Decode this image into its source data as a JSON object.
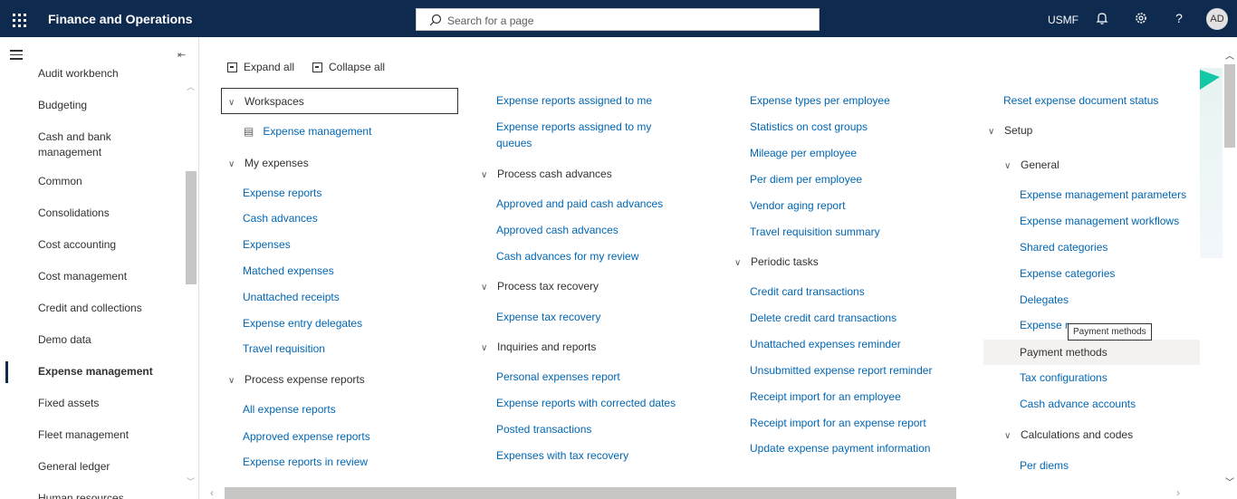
{
  "topbar": {
    "app_title": "Finance and Operations",
    "search_placeholder": "Search for a page",
    "company": "USMF",
    "avatar_initials": "AD",
    "icons": [
      "waffle-icon",
      "search-icon",
      "bell-icon",
      "gear-icon",
      "help-icon"
    ]
  },
  "nav": {
    "items": [
      {
        "label": "Audit workbench"
      },
      {
        "label": "Budgeting"
      },
      {
        "label": "Cash and bank management"
      },
      {
        "label": "Common"
      },
      {
        "label": "Consolidations"
      },
      {
        "label": "Cost accounting"
      },
      {
        "label": "Cost management"
      },
      {
        "label": "Credit and collections"
      },
      {
        "label": "Demo data"
      },
      {
        "label": "Expense management"
      },
      {
        "label": "Fixed assets"
      },
      {
        "label": "Fleet management"
      },
      {
        "label": "General ledger"
      },
      {
        "label": "Human resources"
      }
    ],
    "active": "Expense management"
  },
  "toolbar": {
    "expand_all": "Expand all",
    "collapse_all": "Collapse all"
  },
  "col1": {
    "workspaces": "Workspaces",
    "expense_management": "Expense management",
    "my_expenses": "My expenses",
    "my_expenses_links": [
      "Expense reports",
      "Cash advances",
      "Expenses",
      "Matched expenses",
      "Unattached receipts",
      "Expense entry delegates",
      "Travel requisition"
    ],
    "process_expense_reports": "Process expense reports",
    "process_links": [
      "All expense reports",
      "Approved expense reports",
      "Expense reports in review"
    ]
  },
  "col2": {
    "top_links": [
      "Expense reports assigned to me",
      "Expense reports assigned to my",
      "queues"
    ],
    "process_cash_advances": "Process cash advances",
    "cash_links": [
      "Approved and paid cash advances",
      "Approved cash advances",
      "Cash advances for my review"
    ],
    "process_tax_recovery": "Process tax recovery",
    "tax_links": [
      "Expense tax recovery"
    ],
    "inquiries_and_reports": "Inquiries and reports",
    "inquiry_links": [
      "Personal expenses report",
      "Expense reports with corrected dates",
      "Posted transactions",
      "Expenses with tax recovery"
    ]
  },
  "col3": {
    "top_links": [
      "Expense types per employee",
      "Statistics on cost groups",
      "Mileage per employee",
      "Per diem per employee",
      "Vendor aging report",
      "Travel requisition summary"
    ],
    "periodic_tasks": "Periodic tasks",
    "periodic_links": [
      "Credit card transactions",
      "Delete credit card transactions",
      "Unattached expenses reminder",
      "Unsubmitted expense report reminder",
      "Receipt import for an employee",
      "Receipt import for an expense report",
      "Update expense payment information"
    ]
  },
  "col4": {
    "reset_link": "Reset expense document status",
    "setup": "Setup",
    "general": "General",
    "general_links": [
      "Expense management parameters",
      "Expense management workflows",
      "Shared categories",
      "Expense categories",
      "Delegates",
      "Expense r"
    ],
    "payment_methods": "Payment methods",
    "after_links": [
      "Tax configurations",
      "Cash advance accounts"
    ],
    "calculations_and_codes": "Calculations and codes",
    "calc_links": [
      "Per diems"
    ],
    "tooltip": "Payment methods"
  }
}
